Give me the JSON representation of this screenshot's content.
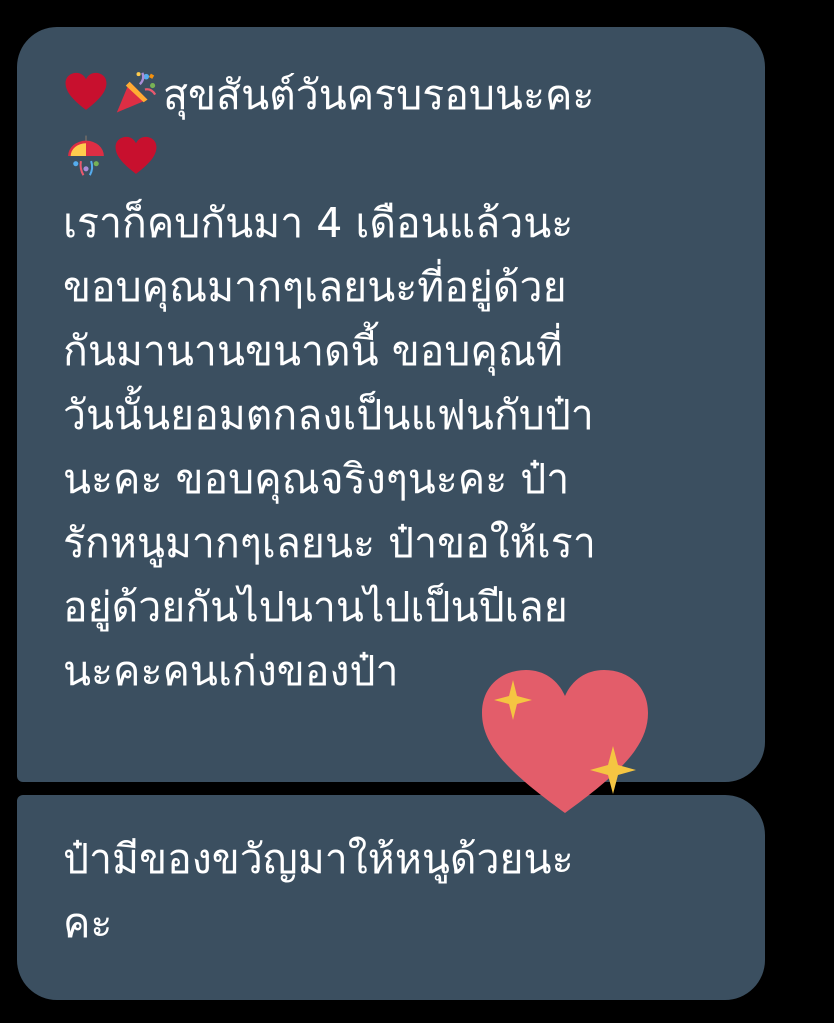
{
  "chat": {
    "messages": [
      {
        "id": "msg-1",
        "icons": [
          "red-heart-icon",
          "party-popper-icon",
          "confetti-ball-icon",
          "red-heart-icon",
          "sparkling-heart-icon"
        ],
        "lines": [
          "สุขสันต์วันครบรอบนะคะ",
          "",
          "เราก็คบกันมา 4 เดือนแล้วนะ",
          "ขอบคุณมากๆเลยนะที่อยู่ด้วย",
          "กันมานานขนาดนี้ ขอบคุณที่",
          "วันนั้นยอมตกลงเป็นแฟนกับป๋า",
          "นะคะ ขอบคุณจริงๆนะคะ ป๋า",
          "รักหนูมากๆเลยนะ ป๋าขอให้เรา",
          "อยู่ด้วยกันไปนานไปเป็นปีเลย",
          "นะคะคนเก่งของป๋า"
        ]
      },
      {
        "id": "msg-2",
        "lines": [
          "ป๋ามีของขวัญมาให้หนูด้วยนะ",
          "คะ"
        ]
      }
    ]
  },
  "colors": {
    "background": "#000000",
    "bubble": "#3b4f60",
    "text": "#ffffff",
    "heart_red": "#c8102e",
    "sparkling_heart": "#e35d6a",
    "sparkle": "#f5c542"
  }
}
